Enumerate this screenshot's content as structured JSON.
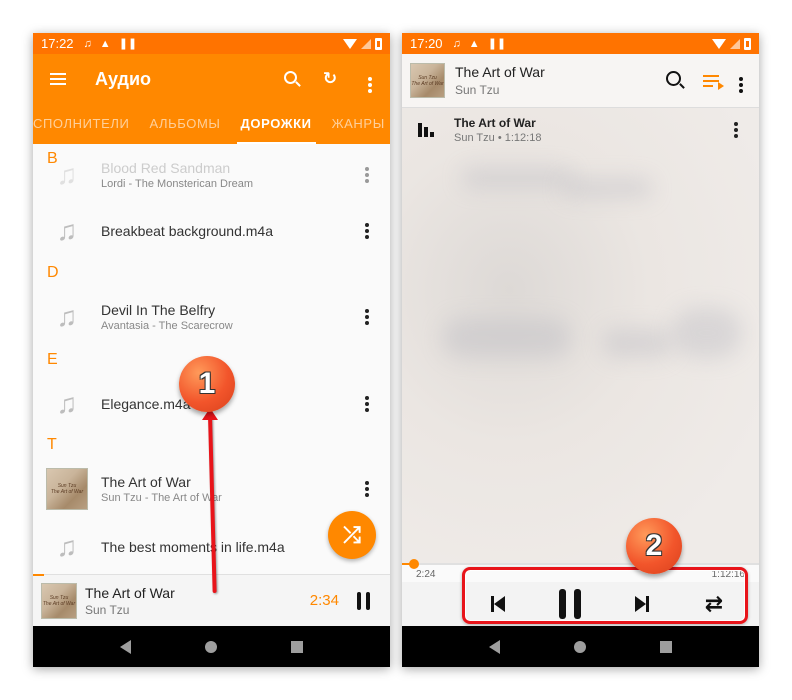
{
  "left_phone": {
    "status_bar": {
      "time": "17:22"
    },
    "app_bar": {
      "title": "Аудио",
      "icons": [
        "menu-icon",
        "search-icon",
        "history-play-icon",
        "more-vert-icon"
      ]
    },
    "tabs": [
      {
        "label": "СПОЛНИТЕЛИ",
        "active": false
      },
      {
        "label": "АЛЬБОМЫ",
        "active": false
      },
      {
        "label": "ДОРОЖКИ",
        "active": true
      },
      {
        "label": "ЖАНРЫ",
        "active": false
      }
    ],
    "sections": [
      {
        "letter": "B"
      },
      {
        "letter": "D"
      },
      {
        "letter": "E"
      },
      {
        "letter": "T"
      }
    ],
    "tracks": [
      {
        "title": "Blood Red Sandman",
        "subtitle": "Lordi - The Monsterican Dream",
        "icon": "music-note-icon"
      },
      {
        "title": "Breakbeat background.m4a",
        "subtitle": "",
        "icon": "music-note-icon"
      },
      {
        "title": "Devil In The Belfry",
        "subtitle": "Avantasia - The Scarecrow",
        "icon": "music-note-icon"
      },
      {
        "title": "Elegance.m4a",
        "subtitle": "",
        "icon": "music-note-icon"
      },
      {
        "title": "The Art of War",
        "subtitle": "Sun Tzu - The Art of War",
        "icon": "album-art"
      },
      {
        "title": "The best moments in life.m4a",
        "subtitle": "",
        "icon": "music-note-icon"
      }
    ],
    "album_art_text": {
      "line1": "Sun Tzu",
      "line2": "The Art of War"
    },
    "fab": {
      "icon": "shuffle-icon",
      "glyph": "⤮"
    },
    "mini_player": {
      "title": "The Art of War",
      "artist": "Sun Tzu",
      "time": "2:34",
      "progress": 0.03
    }
  },
  "right_phone": {
    "status_bar": {
      "time": "17:20"
    },
    "header": {
      "title": "The Art of War",
      "artist": "Sun Tzu"
    },
    "current_track": {
      "title": "The Art of War",
      "subtitle": "Sun Tzu  •  1:12:18"
    },
    "seek": {
      "elapsed": "2:24",
      "total": "1:12:16",
      "progress": 0.033
    },
    "controls": {
      "repeat_glyph": "⇄"
    }
  },
  "annotations": {
    "callout_1": "1",
    "callout_2": "2"
  },
  "colors": {
    "accent": "#ff8800",
    "status_bar": "#ff7300",
    "annotation_red": "#e8141a"
  }
}
